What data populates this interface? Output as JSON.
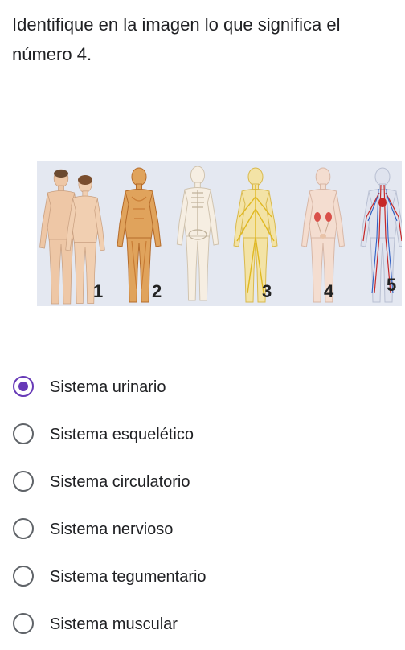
{
  "question": {
    "line1": "Identifique en la imagen lo que significa el",
    "line2": "número 4."
  },
  "figure": {
    "labels": [
      "1",
      "2",
      "3",
      "4",
      "5"
    ]
  },
  "accent_color": "#673ab7",
  "options": [
    {
      "label": "Sistema urinario",
      "selected": true
    },
    {
      "label": "Sistema esquelético",
      "selected": false
    },
    {
      "label": "Sistema circulatorio",
      "selected": false
    },
    {
      "label": "Sistema nervioso",
      "selected": false
    },
    {
      "label": "Sistema tegumentario",
      "selected": false
    },
    {
      "label": "Sistema muscular",
      "selected": false
    }
  ]
}
